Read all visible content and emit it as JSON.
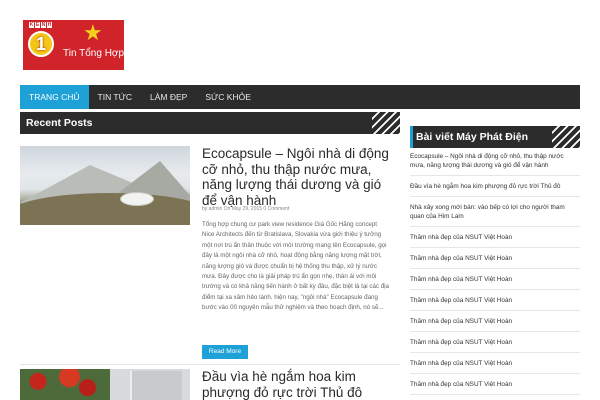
{
  "logo": {
    "kenh": [
      "K",
      "Ê",
      "N",
      "H"
    ],
    "number": "1",
    "brand": "Tin Tổng Hợp"
  },
  "nav": {
    "items": [
      "TRANG CHỦ",
      "TIN TỨC",
      "LÀM ĐẸP",
      "SỨC KHỎE"
    ]
  },
  "recent": {
    "title": "Recent Posts",
    "posts": [
      {
        "title": "Ecocapsule – Ngôi nhà di động cỡ nhỏ, thu thập nước mưa, năng lượng thái dương và gió để vận hành",
        "meta": "by admin On May 29, 2015 0 Comment",
        "excerpt": "Tổng hợp chung cư park view residence Giá Gốc Hãng concept Nice Architects đến từ Bratislava, Slovakia vừa giới thiệu ý tưởng một nơi trú ẩn thân thuộc với môi trường mang tên Ecocapsule, gọi đây là một ngôi nhà cỡ nhỏ, hoạt động bằng năng lượng mặt trời, năng lượng gió và được chuẩn bị hệ thống thu thập, xử lý nước mưa. Đây được cho là giải pháp trú ẩn gọn nhẹ, thân ái với môi trường và có khả năng tiến hành ở bất kỳ đâu, đặc biệt là tại các địa điểm tại xa xăm hẻo lánh. hiện nay, \"ngôi nhà\" Ecocapsule đang bước vào 00 nguyên mẫu thử nghiệm và theo hoạch định, nó sẽ...",
        "read_more": "Read More"
      },
      {
        "title": "Đầu vìa hè ngắm hoa kim phượng đỏ rực trời Thủ đô"
      }
    ]
  },
  "sidebar": {
    "title": "Bài viết Máy Phát Điện",
    "items": [
      "Ecocapsule – Ngôi nhà di động cỡ nhỏ, thu thập nước mưa, năng lượng thái dương và gió để vận hành",
      "Đầu vìa hè ngắm hoa kim phượng đỏ rực trời Thủ đô",
      "Nhà xây xong mới bán: vào bếp có lợi cho người tham quan của Him Lam",
      "Thăm nhà đẹp của NSUT Việt Hoàn",
      "Thăm nhà đẹp của NSUT Việt Hoàn",
      "Thăm nhà đẹp của NSUT Việt Hoàn",
      "Thăm nhà đẹp của NSUT Việt Hoàn",
      "Thăm nhà đẹp của NSUT Việt Hoàn",
      "Thăm nhà đẹp của NSUT Việt Hoàn",
      "Thăm nhà đẹp của NSUT Việt Hoàn",
      "Thăm nhà đẹp của NSUT Việt Hoàn"
    ]
  },
  "colors": {
    "accent": "#1da1d6",
    "dark": "#2c2c2c",
    "logo_red": "#d0232a",
    "logo_yellow": "#f5c518"
  },
  "icons": {
    "star": "★"
  }
}
